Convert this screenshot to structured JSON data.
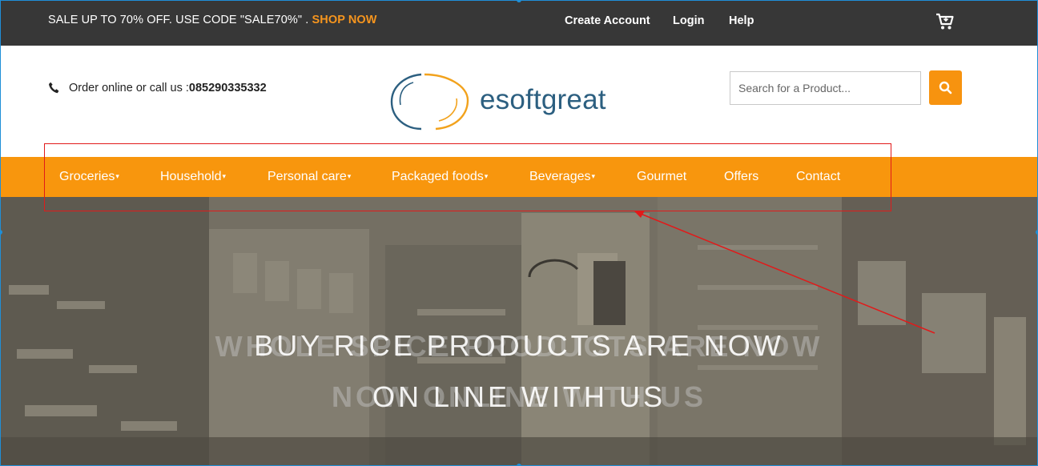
{
  "topbar": {
    "promo_text": "SALE UP TO 70% OFF. USE CODE \"SALE70%\" . ",
    "shop_now": "SHOP NOW",
    "links": [
      "Create Account",
      "Login",
      "Help"
    ],
    "cart_icon": "cart-icon"
  },
  "header": {
    "contact_prefix": "Order online or call us : ",
    "phone_number": "085290335332",
    "logo_text": "esoftgreat",
    "search": {
      "placeholder": "Search for a Product...",
      "value": ""
    }
  },
  "nav": {
    "items": [
      {
        "label": "Groceries",
        "dropdown": true
      },
      {
        "label": "Household",
        "dropdown": true
      },
      {
        "label": "Personal care",
        "dropdown": true
      },
      {
        "label": "Packaged foods",
        "dropdown": true
      },
      {
        "label": "Beverages",
        "dropdown": true
      },
      {
        "label": "Gourmet",
        "dropdown": false
      },
      {
        "label": "Offers",
        "dropdown": false
      },
      {
        "label": "Contact",
        "dropdown": false
      }
    ],
    "caret": "▾"
  },
  "hero": {
    "line1_front": "BUY RICE PRODUCTS ARE NOW",
    "line2_front": "ON LINE WITH US",
    "line1_ghost": "WHOLE SPICE PRODUCTS ARE NOW",
    "line2_ghost": "NOW ONLINE WITH US"
  },
  "colors": {
    "accent": "#f8960d",
    "topbar_bg": "#373737",
    "annotation": "#e11a1a"
  }
}
